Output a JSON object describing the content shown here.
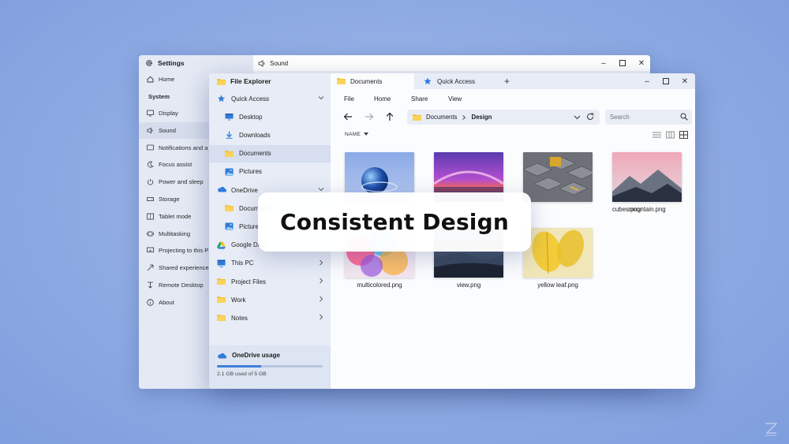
{
  "settings": {
    "title": "Settings",
    "sound_title": "Sound",
    "home": "Home",
    "section": "System",
    "items": [
      {
        "label": "Display",
        "icon": "monitor-icon"
      },
      {
        "label": "Sound",
        "icon": "speaker-icon",
        "selected": true
      },
      {
        "label": "Notifications and a",
        "icon": "notification-icon"
      },
      {
        "label": "Focus assist",
        "icon": "moon-icon"
      },
      {
        "label": "Power and sleep",
        "icon": "power-icon"
      },
      {
        "label": "Storage",
        "icon": "storage-icon"
      },
      {
        "label": "Tablet mode",
        "icon": "tablet-icon"
      },
      {
        "label": "Multitasking",
        "icon": "multitasking-icon"
      },
      {
        "label": "Projecting to this P",
        "icon": "projector-icon"
      },
      {
        "label": "Shared experience",
        "icon": "share-icon"
      },
      {
        "label": "Remote Desktop",
        "icon": "remote-icon"
      },
      {
        "label": "About",
        "icon": "info-icon"
      }
    ]
  },
  "explorer": {
    "title": "File Explorer",
    "nav": [
      {
        "label": "Quick Access",
        "icon": "star-icon",
        "level": 1,
        "chevron": "down"
      },
      {
        "label": "Desktop",
        "icon": "desktop-icon",
        "level": 2
      },
      {
        "label": "Downloads",
        "icon": "download-icon",
        "level": 2
      },
      {
        "label": "Documents",
        "icon": "folder-icon",
        "level": 2,
        "selected": true
      },
      {
        "label": "Pictures",
        "icon": "pictures-icon",
        "level": 2
      },
      {
        "label": "OneDrive",
        "icon": "cloud-icon",
        "level": 1,
        "chevron": "down"
      },
      {
        "label": "Documents",
        "icon": "folder-icon",
        "level": 2
      },
      {
        "label": "Pictures",
        "icon": "pictures-icon",
        "level": 2
      },
      {
        "label": "Google Drive",
        "icon": "google-drive-icon",
        "level": 1
      },
      {
        "label": "This PC",
        "icon": "pc-icon",
        "level": 1,
        "chevron": "right"
      },
      {
        "label": "Project Files",
        "icon": "folder-icon",
        "level": 1,
        "chevron": "right"
      },
      {
        "label": "Work",
        "icon": "folder-icon",
        "level": 1,
        "chevron": "right"
      },
      {
        "label": "Notes",
        "icon": "folder-icon",
        "level": 1,
        "chevron": "right"
      }
    ],
    "usage": {
      "title": "OneDrive usage",
      "text": "2.1 GB used of 5 GB",
      "fraction": 0.42
    },
    "tabs": [
      {
        "label": "Documents",
        "icon": "folder-icon",
        "active": true
      },
      {
        "label": "Quick Access",
        "icon": "star-icon",
        "active": false
      }
    ],
    "menu": [
      "File",
      "Home",
      "Share",
      "View"
    ],
    "address": {
      "root": "Documents",
      "current": "Design"
    },
    "search_placeholder": "Search",
    "sort_label": "NAME",
    "files": [
      {
        "name": "",
        "thumb": "glass-sphere"
      },
      {
        "name": "",
        "thumb": "purple-arc"
      },
      {
        "name": "cubes.png",
        "thumb": "cubes"
      },
      {
        "name": "mountain.png",
        "thumb": "mountain"
      },
      {
        "name": "multicolored.png",
        "thumb": "multicolored"
      },
      {
        "name": "view.png",
        "thumb": "view"
      },
      {
        "name": "yellow leaf.png",
        "thumb": "yellow-leaf"
      }
    ]
  },
  "overlay": {
    "text": "Consistent Design"
  },
  "colors": {
    "accent": "#3f7fd9",
    "folder": "#f5c23a",
    "background": "#8eaae3"
  }
}
